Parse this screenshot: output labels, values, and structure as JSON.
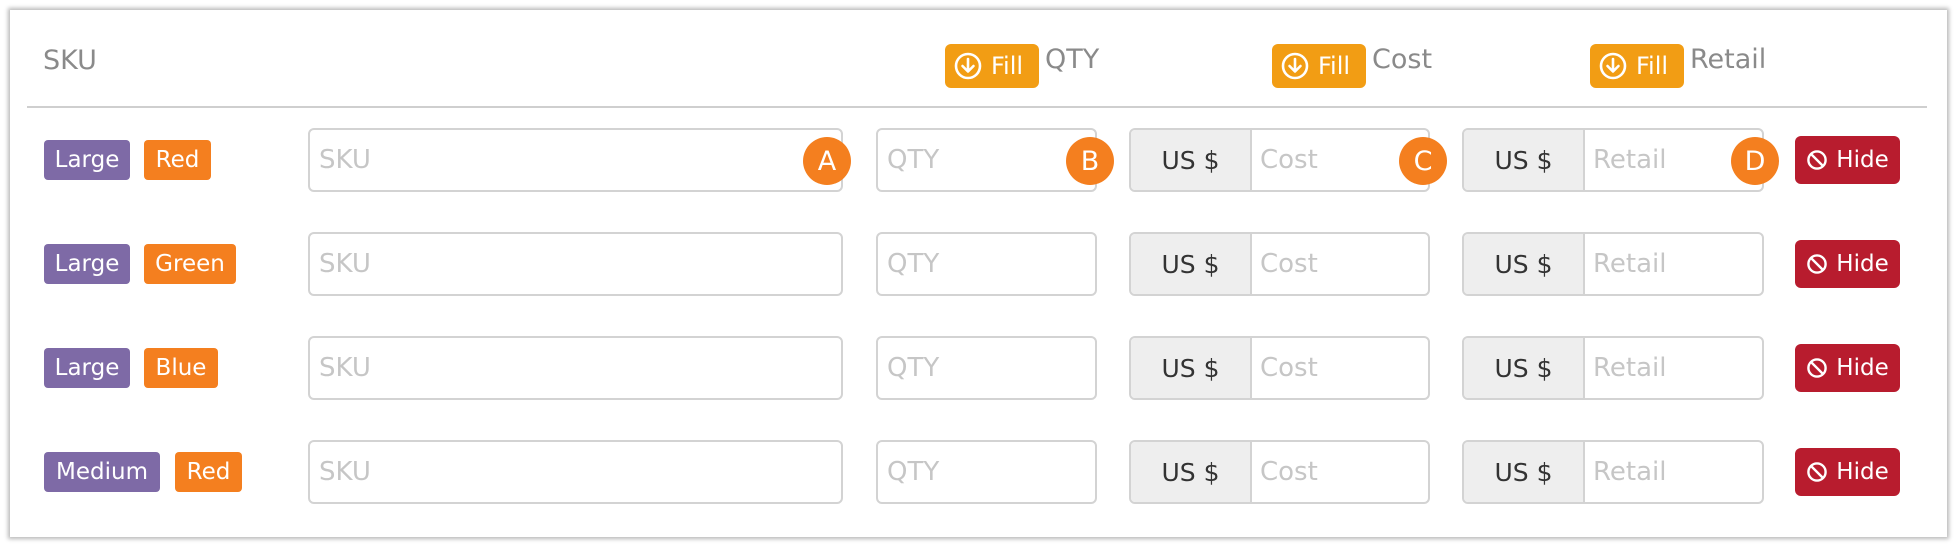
{
  "header": {
    "sku_label": "SKU",
    "fill_label": "Fill",
    "qty_label": "QTY",
    "cost_label": "Cost",
    "retail_label": "Retail"
  },
  "currency": "US $",
  "placeholders": {
    "sku": "SKU",
    "qty": "QTY",
    "cost": "Cost",
    "retail": "Retail"
  },
  "hide_label": "Hide",
  "rows": [
    {
      "size": "Large",
      "color": "Red"
    },
    {
      "size": "Large",
      "color": "Green"
    },
    {
      "size": "Large",
      "color": "Blue"
    },
    {
      "size": "Medium",
      "color": "Red"
    }
  ],
  "markers": [
    "A",
    "B",
    "C",
    "D"
  ],
  "colors": {
    "fill_button": "#f29d14",
    "size_badge": "#7e6aa6",
    "color_badge": "#f47f1f",
    "hide_button": "#b81c2e",
    "marker": "#f47f1f"
  },
  "icons": {
    "fill": "arrow-down-circle-icon",
    "hide": "ban-icon"
  }
}
